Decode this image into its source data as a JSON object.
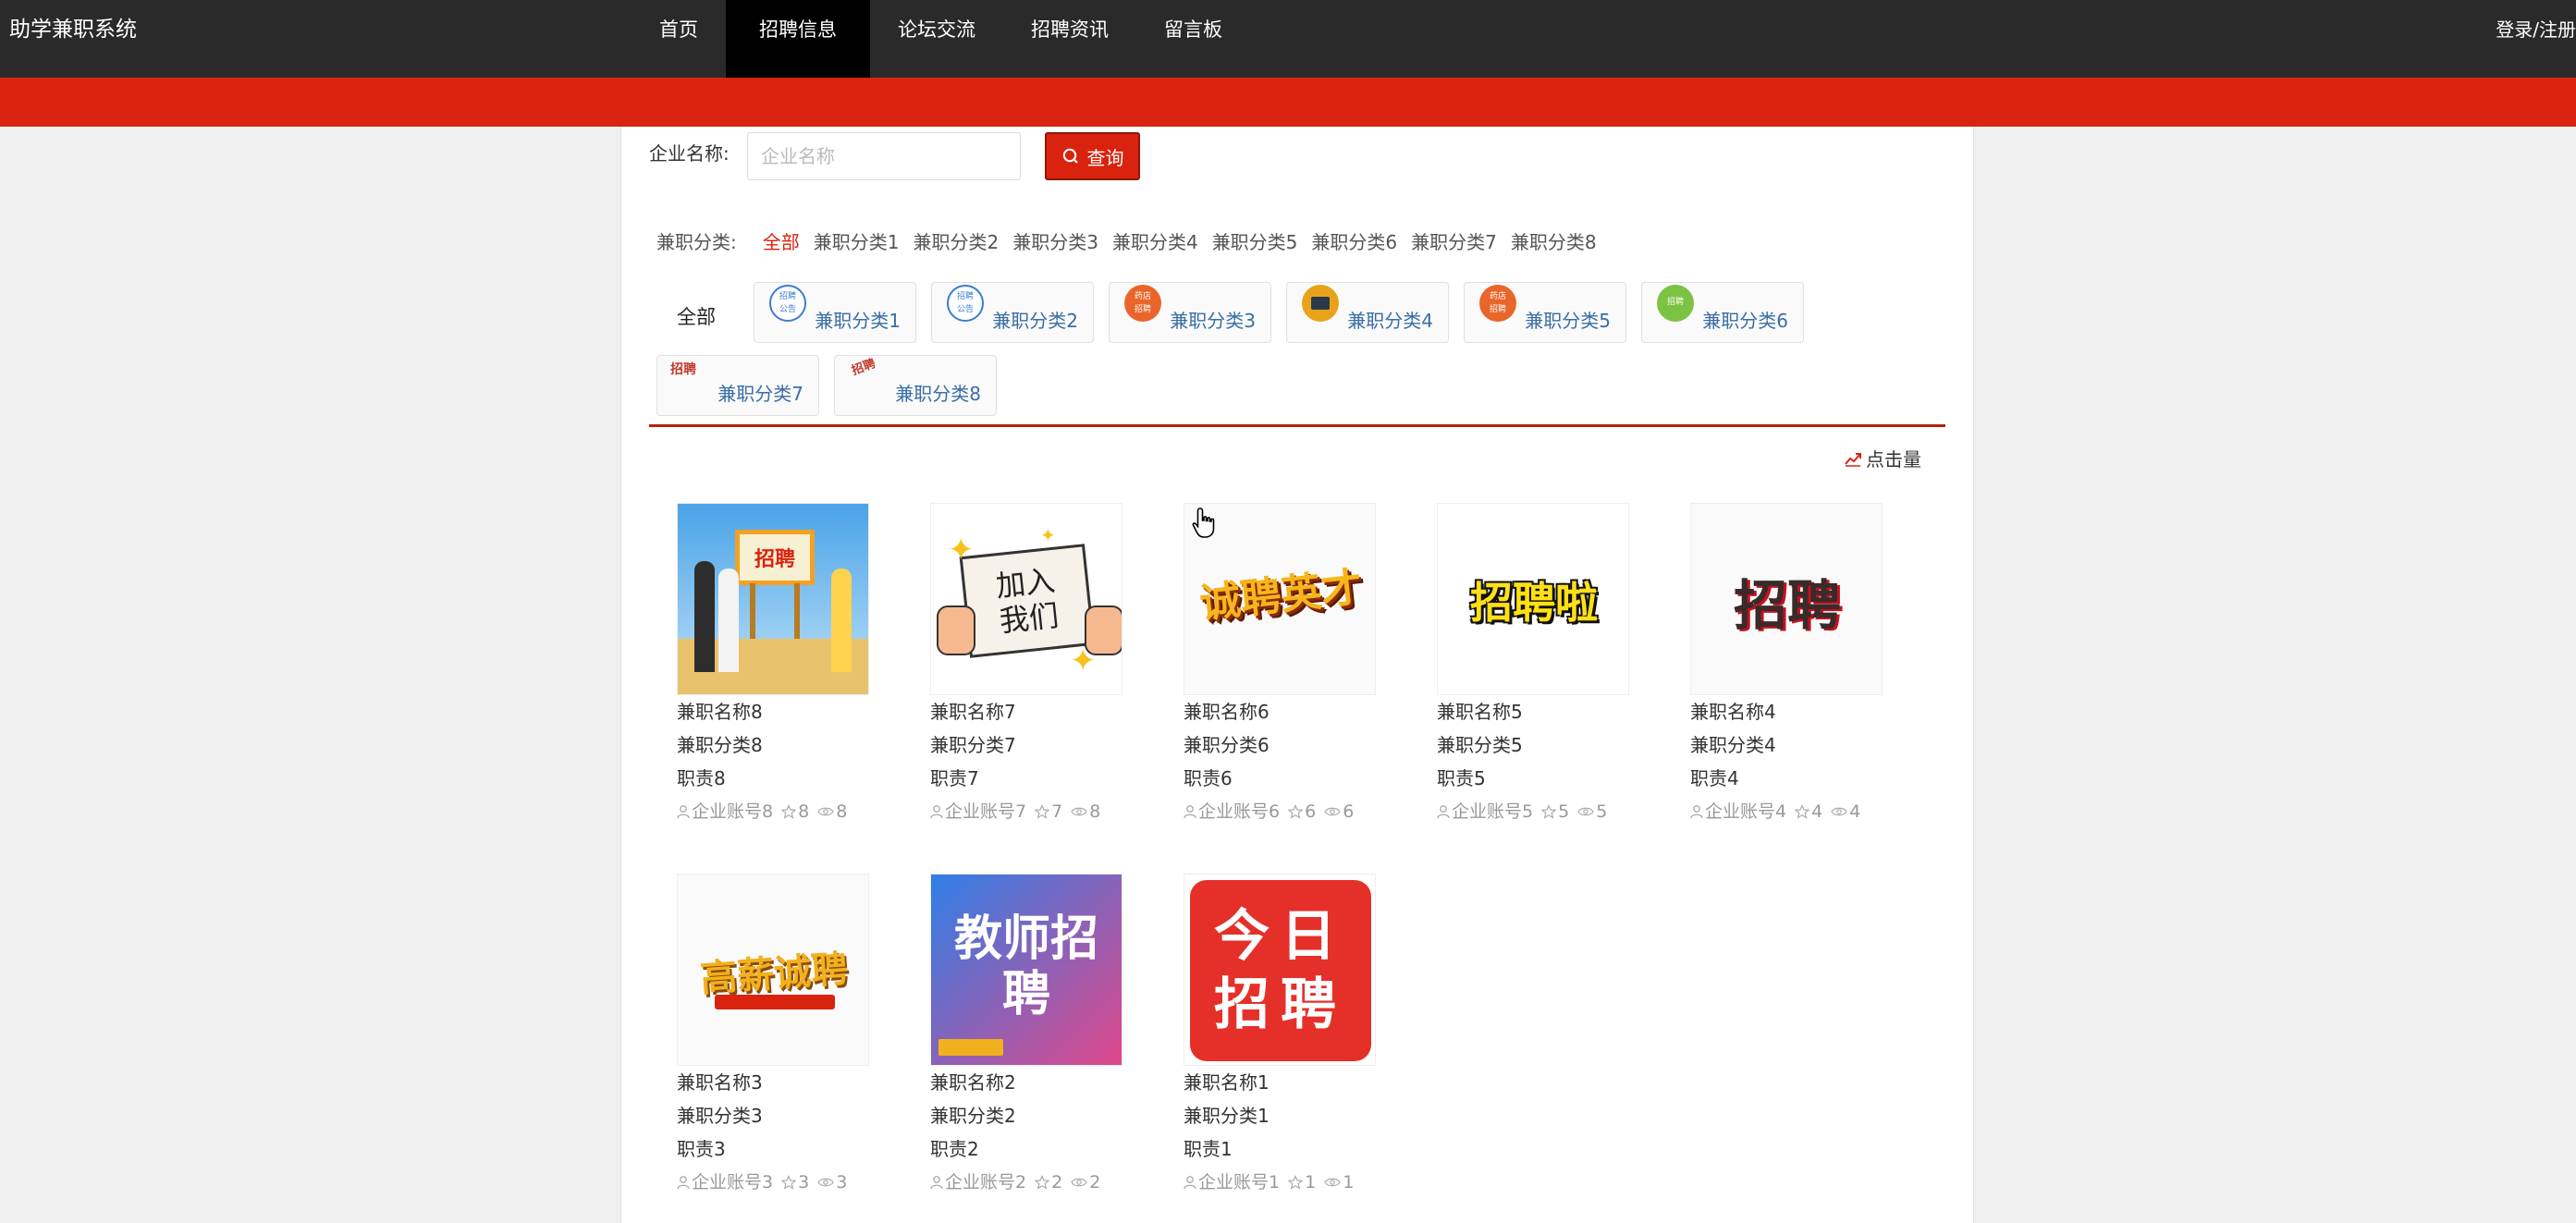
{
  "header": {
    "brand": "助学兼职系统",
    "nav": [
      "首页",
      "招聘信息",
      "论坛交流",
      "招聘资讯",
      "留言板"
    ],
    "active_nav": "招聘信息",
    "login": "登录/注册"
  },
  "colors": {
    "accent": "#d9230e",
    "nav_bg": "#2a2a2a",
    "link": "#3a6ea5"
  },
  "search": {
    "label": "企业名称:",
    "placeholder": "企业名称",
    "button": "查询"
  },
  "category_filter": {
    "label": "兼职分类:",
    "items": [
      "全部",
      "兼职分类1",
      "兼职分类2",
      "兼职分类3",
      "兼职分类4",
      "兼职分类5",
      "兼职分类6",
      "兼职分类7",
      "兼职分类8"
    ],
    "active": "全部"
  },
  "category_cards": {
    "all": "全部",
    "items": [
      {
        "label": "兼职分类1",
        "icon": "recruit-notice-icon",
        "color": "#3b7bd6",
        "text": "招聘"
      },
      {
        "label": "兼职分类2",
        "icon": "recruit-notice-icon",
        "color": "#3b7bd6",
        "text": "招聘"
      },
      {
        "label": "兼职分类3",
        "icon": "shop-hiring-icon",
        "color": "#e9652a",
        "text": "药店"
      },
      {
        "label": "兼职分类4",
        "icon": "building-icon",
        "color": "#e8a31b",
        "text": ""
      },
      {
        "label": "兼职分类5",
        "icon": "shop-hiring-icon",
        "color": "#e9652a",
        "text": "药店"
      },
      {
        "label": "兼职分类6",
        "icon": "green-badge-icon",
        "color": "#7cc243",
        "text": "招聘"
      },
      {
        "label": "兼职分类7",
        "icon": "recruit-text-icon",
        "color": "#c0392b",
        "text": "招聘"
      },
      {
        "label": "兼职分类8",
        "icon": "recruit-text-icon",
        "color": "#c0392b",
        "text": "招聘"
      }
    ]
  },
  "sort": {
    "label": "点击量"
  },
  "jobs": [
    {
      "name": "兼职名称8",
      "category": "兼职分类8",
      "duty": "职责8",
      "account": "企业账号8",
      "stars": "8",
      "views": "8",
      "thumb_text": "招聘",
      "thumb": "blue-scene"
    },
    {
      "name": "兼职名称7",
      "category": "兼职分类7",
      "duty": "职责7",
      "account": "企业账号7",
      "stars": "7",
      "views": "8",
      "thumb_text": "加入我们",
      "thumb": "paper"
    },
    {
      "name": "兼职名称6",
      "category": "兼职分类6",
      "duty": "职责6",
      "account": "企业账号6",
      "stars": "6",
      "views": "6",
      "thumb_text": "诚聘英才",
      "thumb": "gold-3d"
    },
    {
      "name": "兼职名称5",
      "category": "兼职分类5",
      "duty": "职责5",
      "account": "企业账号5",
      "stars": "5",
      "views": "5",
      "thumb_text": "招聘啦",
      "thumb": "yellow-black"
    },
    {
      "name": "兼职名称4",
      "category": "兼职分类4",
      "duty": "职责4",
      "account": "企业账号4",
      "stars": "4",
      "views": "4",
      "thumb_text": "招聘",
      "thumb": "dark-red"
    },
    {
      "name": "兼职名称3",
      "category": "兼职分类3",
      "duty": "职责3",
      "account": "企业账号3",
      "stars": "3",
      "views": "3",
      "thumb_text": "高薪诚聘",
      "thumb": "gold-3d"
    },
    {
      "name": "兼职名称2",
      "category": "兼职分类2",
      "duty": "职责2",
      "account": "企业账号2",
      "stars": "2",
      "views": "2",
      "thumb_text": "教师招聘",
      "thumb": "teacher"
    },
    {
      "name": "兼职名称1",
      "category": "兼职分类1",
      "duty": "职责1",
      "account": "企业账号1",
      "stars": "1",
      "views": "1",
      "thumb_text": "今日招聘",
      "thumb": "red-box"
    }
  ]
}
